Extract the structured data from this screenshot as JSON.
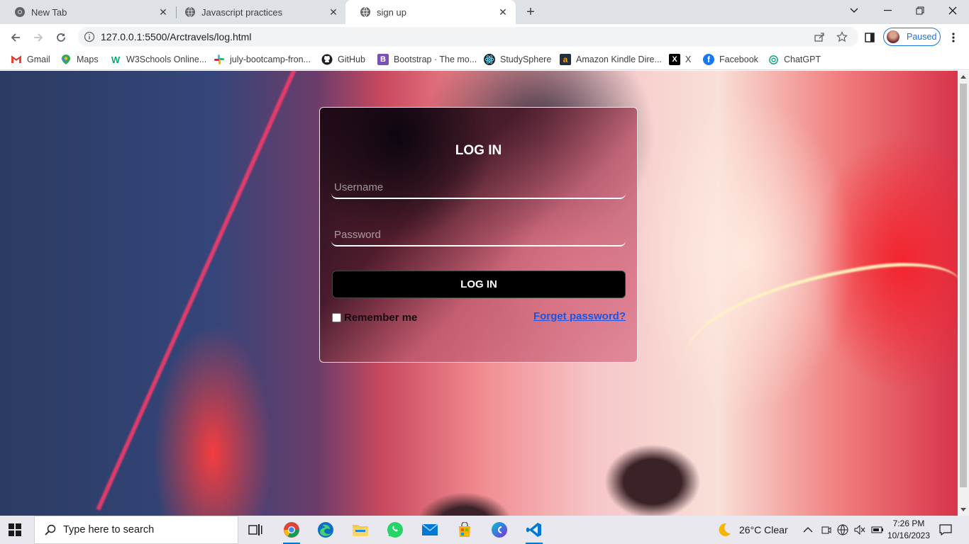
{
  "browser": {
    "tabs": [
      {
        "title": "New Tab"
      },
      {
        "title": "Javascript practices"
      },
      {
        "title": "sign up"
      }
    ],
    "address": "127.0.0.1:5500/Arctravels/log.html",
    "profile_label": "Paused",
    "bookmarks": [
      {
        "label": "Gmail",
        "icon": "gmail-icon"
      },
      {
        "label": "Maps",
        "icon": "maps-icon"
      },
      {
        "label": "W3Schools Online...",
        "icon": "w3schools-icon"
      },
      {
        "label": "july-bootcamp-fron...",
        "icon": "slack-icon"
      },
      {
        "label": "GitHub",
        "icon": "github-icon"
      },
      {
        "label": "Bootstrap · The mo...",
        "icon": "bootstrap-icon"
      },
      {
        "label": "StudySphere",
        "icon": "react-icon"
      },
      {
        "label": "Amazon Kindle Dire...",
        "icon": "amazon-icon"
      },
      {
        "label": "X",
        "icon": "x-icon"
      },
      {
        "label": "Facebook",
        "icon": "facebook-icon"
      },
      {
        "label": "ChatGPT",
        "icon": "chatgpt-icon"
      }
    ]
  },
  "login": {
    "title": "LOG IN",
    "username_placeholder": "Username",
    "password_placeholder": "Password",
    "submit_label": "LOG IN",
    "remember_label": "Remember me",
    "remember_checked": false,
    "forgot_label": "Forget password?"
  },
  "taskbar": {
    "search_placeholder": "Type here to search",
    "weather": "26°C  Clear",
    "time": "7:26 PM",
    "date": "10/16/2023"
  },
  "colors": {
    "accent": "#1a73e8",
    "link": "#1a55e3",
    "button_bg": "#000000"
  }
}
